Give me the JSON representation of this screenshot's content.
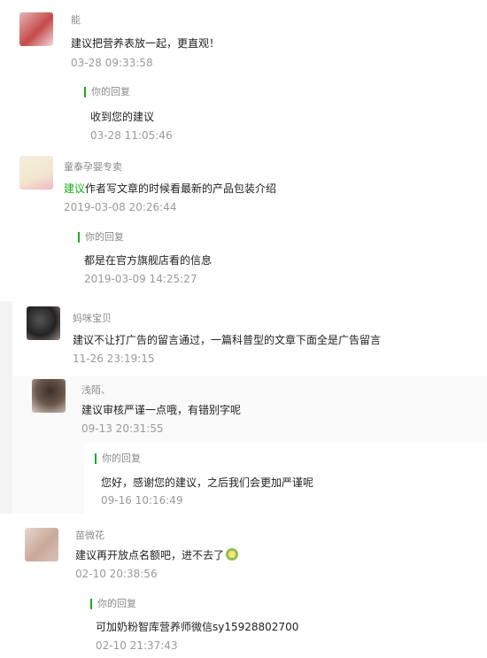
{
  "comments": [
    {
      "name": "能",
      "text": "建议把营养表放一起，更直观！",
      "time": "03-28 09:33:58",
      "reply": {
        "label": "你的回复",
        "text": "收到您的建议",
        "time": "03-28 11:05:46"
      },
      "avatar_colors": [
        "#c54a4a",
        "#e6b3b3"
      ]
    },
    {
      "name": "童泰孕婴专卖",
      "text_highlight": "建议",
      "text": "作者写文章的时候看最新的产品包装介绍",
      "time": "2019-03-08 20:26:44",
      "reply": {
        "label": "你的回复",
        "text": "都是在官方旗舰店看的信息",
        "time": "2019-03-09 14:25:27"
      },
      "avatar_colors": [
        "#f2e6d0",
        "#f0b9c0"
      ]
    },
    {
      "name": "妈咪宝贝",
      "text": "建议不让打广告的留言通过，一篇科普型的文章下面全是广告留言",
      "time": "11-26 23:19:15",
      "avatar_colors": [
        "#333333",
        "#9a8a80"
      ]
    },
    {
      "name": "浅陌、",
      "text": "建议审核严谨一点哦，有错别字呢",
      "time": "09-13 20:31:55",
      "reply": {
        "label": "你的回复",
        "text": "您好，感谢您的建议，之后我们会更加严谨呢",
        "time": "09-16 10:16:49"
      },
      "avatar_colors": [
        "#6d5a4e",
        "#d7ccc8"
      ]
    },
    {
      "name": "苗微花",
      "text": "建议再开放点名额吧，进不去了",
      "time": "02-10 20:38:56",
      "reply": {
        "label": "你的回复",
        "text": "可加奶粉智库营养师微信sy15928802700",
        "time": "02-10 21:37:43"
      },
      "avatar_colors": [
        "#d9c2b8",
        "#c8a99a"
      ]
    }
  ]
}
